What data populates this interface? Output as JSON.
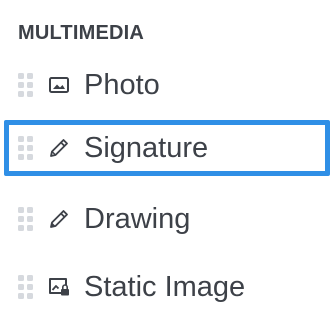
{
  "section": {
    "title": "MULTIMEDIA"
  },
  "items": [
    {
      "label": "Photo",
      "icon": "image-icon",
      "selected": false
    },
    {
      "label": "Signature",
      "icon": "pen-icon",
      "selected": true
    },
    {
      "label": "Drawing",
      "icon": "pencil-icon",
      "selected": false
    },
    {
      "label": "Static Image",
      "icon": "image-lock-icon",
      "selected": false
    }
  ],
  "colors": {
    "selection_border": "#2f8fe6",
    "text": "#3d4148",
    "handle": "#d6d9de"
  }
}
